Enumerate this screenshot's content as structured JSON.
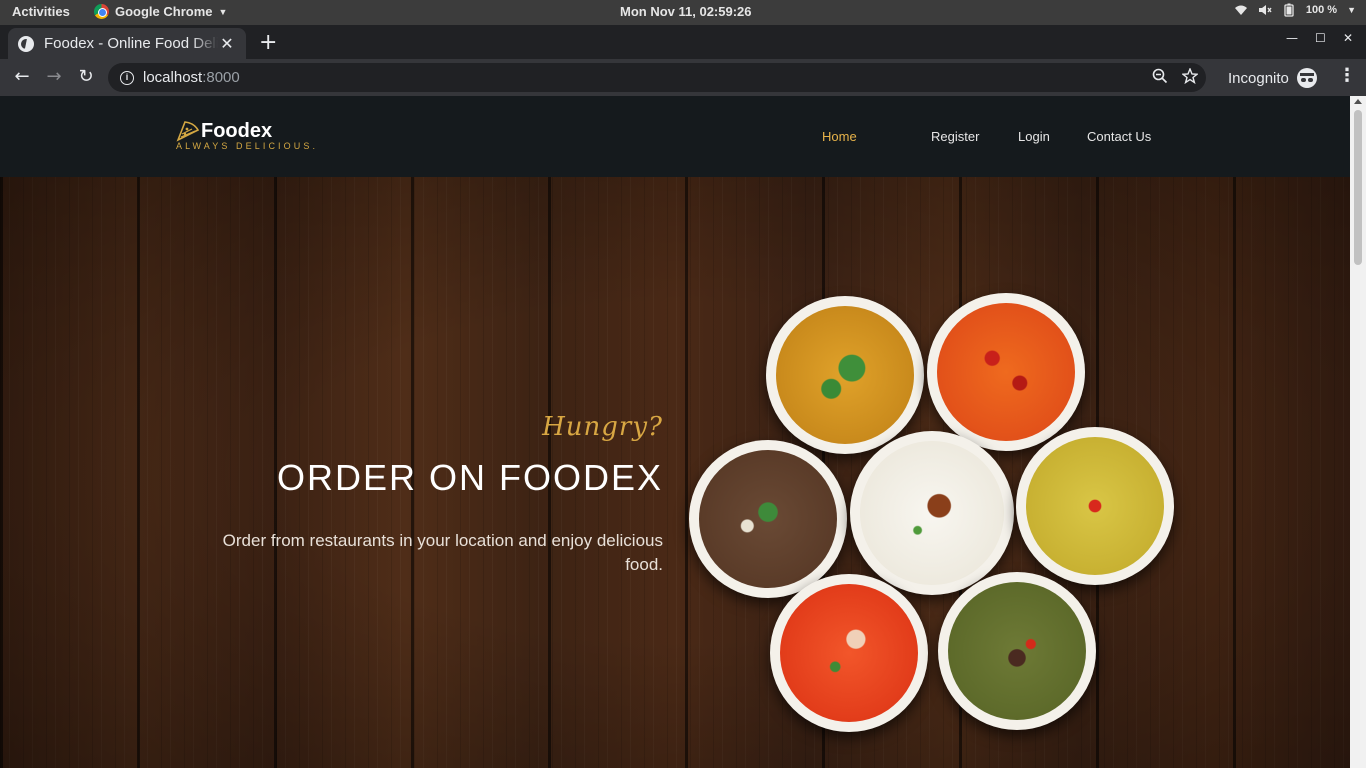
{
  "os_bar": {
    "activities": "Activities",
    "app_name": "Google Chrome",
    "clock": "Mon Nov 11, 02:59:26",
    "battery": "100 %"
  },
  "browser": {
    "tab_title": "Foodex - Online Food Delivery",
    "address_host": "localhost",
    "address_port": ":8000",
    "profile": "Incognito"
  },
  "site": {
    "logo_name": "Foodex",
    "logo_tagline": "ALWAYS DELICIOUS.",
    "nav": {
      "home": "Home",
      "register": "Register",
      "login": "Login",
      "contact": "Contact Us"
    },
    "hero": {
      "kicker": "Hungry?",
      "headline": "ORDER ON FOODEX",
      "subtext": "Order from restaurants in your location and enjoy delicious food."
    }
  },
  "colors": {
    "accent": "#e7b34a",
    "header_bg": "#151a1d",
    "wood": "#4a2a17"
  }
}
